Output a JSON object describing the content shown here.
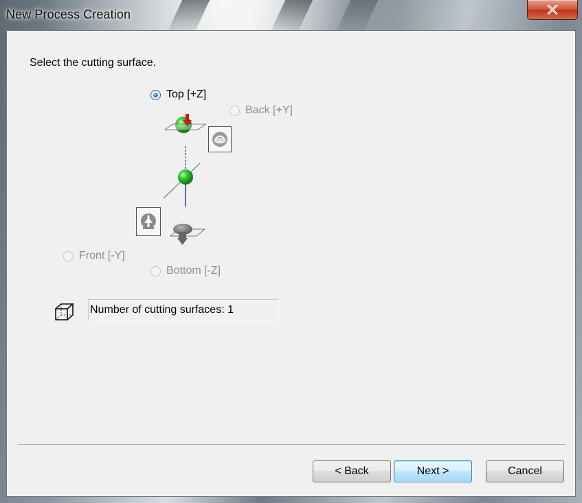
{
  "window": {
    "title": "New Process Creation",
    "close_label": "×"
  },
  "instruction": "Select the cutting surface.",
  "options": {
    "top": {
      "label": "Top [+Z]",
      "selected": true,
      "enabled": true
    },
    "back": {
      "label": "Back [+Y]",
      "selected": false,
      "enabled": false
    },
    "front": {
      "label": "Front [-Y]",
      "selected": false,
      "enabled": false
    },
    "bottom": {
      "label": "Bottom [-Z]",
      "selected": false,
      "enabled": false
    }
  },
  "surface_count": "Number of cutting surfaces: 1",
  "buttons": {
    "back": "< Back",
    "next": "Next >",
    "cancel": "Cancel"
  },
  "colors": {
    "accent_green": "#2fc42f",
    "axis_blue": "#1f2fb0",
    "arrow_red": "#d11a1a"
  }
}
